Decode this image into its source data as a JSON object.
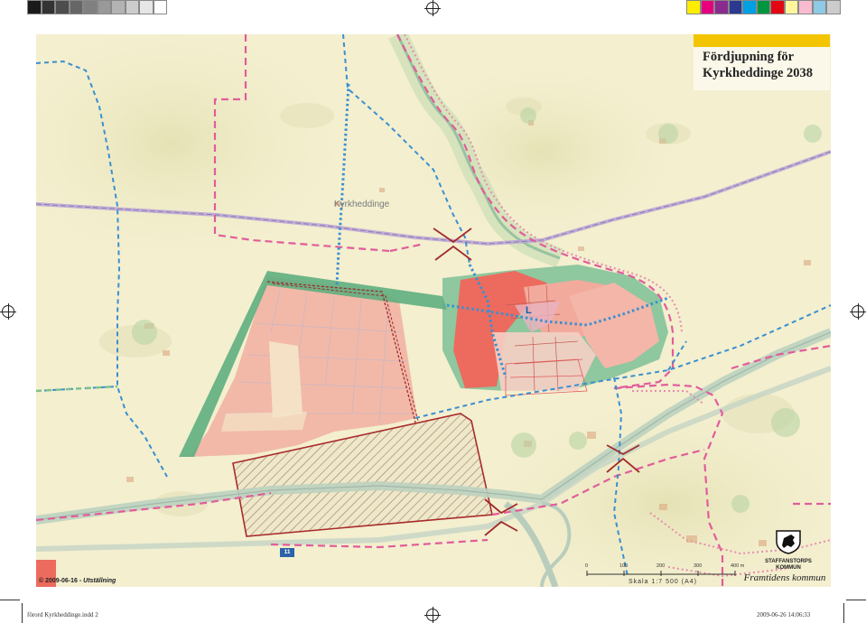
{
  "colors": {
    "grays": [
      "#1a1a1a",
      "#333333",
      "#4d4d4d",
      "#666666",
      "#808080",
      "#999999",
      "#b3b3b3",
      "#cccccc",
      "#e6e6e6",
      "#ffffff"
    ],
    "process": [
      "#ffed00",
      "#e6007e",
      "#8a2b8f",
      "#2b3990",
      "#00a0e3",
      "#009640",
      "#e30613",
      "#fff59d",
      "#f8bbd0",
      "#8ecae6",
      "#cccccc"
    ]
  },
  "map": {
    "title_line1": "Fördjupning för",
    "title_line2": "Kyrkheddinge 2038",
    "place_label": "Kyrkheddinge",
    "area_letter": "L",
    "road_number": "11",
    "stamp_date": "© 2009-06-16 - ",
    "stamp_status": "Utställning"
  },
  "scale": {
    "ticks": [
      "0",
      "100",
      "200",
      "300",
      "400 m"
    ],
    "text": "Skala 1:7 500 (A4)"
  },
  "logo": {
    "name_line1": "STAFFANSTORPS",
    "name_line2": "KOMMUN",
    "tagline": "Framtidens kommun"
  },
  "footer": {
    "file": "förord Kyrkheddinge.indd   2",
    "datetime": "2009-06-26   14:06:33"
  }
}
